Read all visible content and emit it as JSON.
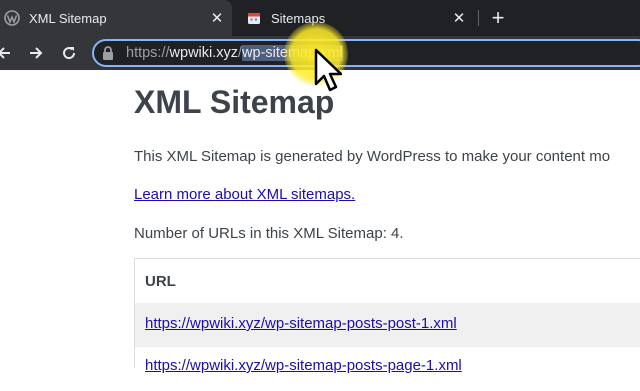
{
  "browser": {
    "tabs": [
      {
        "title": "XML Sitemap",
        "favicon": "wordpress-icon",
        "active": true
      },
      {
        "title": "Sitemaps",
        "favicon": "calendar-icon",
        "active": false
      }
    ],
    "new_tab": "+",
    "url": {
      "scheme": "https://",
      "host": "wpwiki.xyz",
      "slash": "/",
      "path": "wp-sitemap.xml"
    }
  },
  "page": {
    "title": "XML Sitemap",
    "description": "This XML Sitemap is generated by WordPress to make your content mo",
    "learn_more": "Learn more about XML sitemaps.",
    "url_count": "Number of URLs in this XML Sitemap: 4.",
    "table": {
      "header": "URL",
      "rows": [
        "https://wpwiki.xyz/wp-sitemap-posts-post-1.xml",
        "https://wpwiki.xyz/wp-sitemap-posts-page-1.xml"
      ]
    }
  },
  "colors": {
    "tab_bar": "#202124",
    "toolbar": "#35363a",
    "omnibox_focus": "#8ab4f8",
    "link": "#1a0dab",
    "cursor_highlight": "#ffec28"
  }
}
